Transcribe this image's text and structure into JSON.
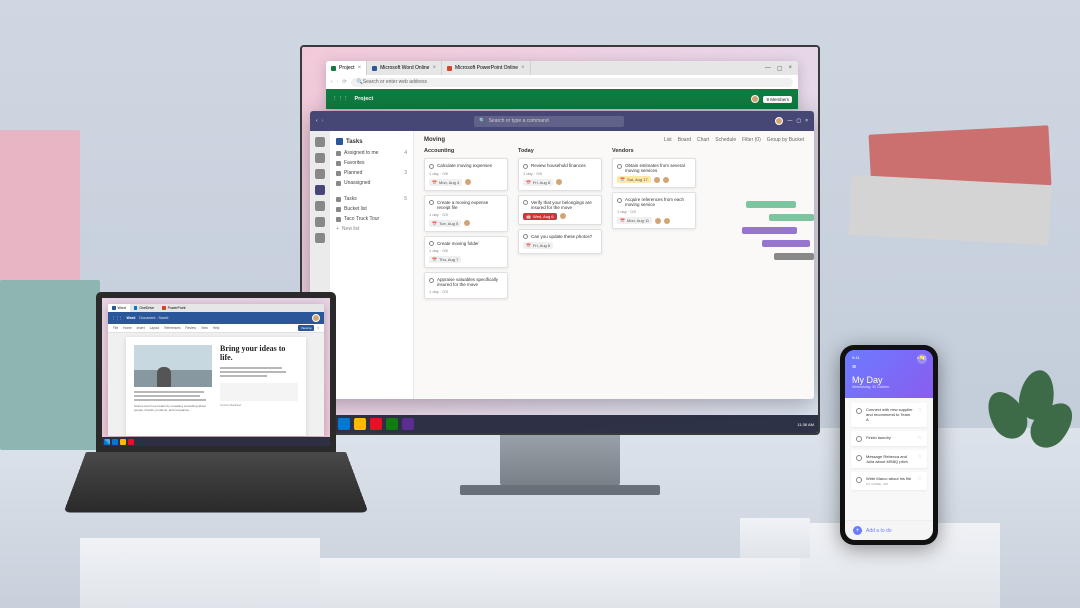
{
  "monitor": {
    "browser": {
      "tabs": [
        {
          "label": "Project",
          "color": "#107c41"
        },
        {
          "label": "Microsoft Word Online",
          "color": "#2b579a"
        },
        {
          "label": "Microsoft PowerPoint Online",
          "color": "#d24726"
        }
      ],
      "address_placeholder": "Search or enter web address",
      "ribbon_app": "Project",
      "ribbon_search": "Search or type a command",
      "member_count": "9 Members"
    },
    "tasks": {
      "title": "Tasks",
      "search_placeholder": "Search or type a command",
      "sidebar": [
        {
          "label": "Assigned to me",
          "count": "4"
        },
        {
          "label": "Favorites",
          "count": ""
        },
        {
          "label": "Planned",
          "count": "3"
        },
        {
          "label": "Unassigned",
          "count": ""
        }
      ],
      "sidebar_lists": [
        {
          "label": "Tasks",
          "count": "5"
        },
        {
          "label": "Bucket list",
          "count": ""
        },
        {
          "label": "Taco Truck Tour",
          "count": ""
        }
      ],
      "sidebar_new": "New list",
      "board_title": "Moving",
      "board_tabs": [
        "List",
        "Board",
        "Chart",
        "Schedule"
      ],
      "board_filter": "Filter (0)",
      "board_group": "Group by Bucket",
      "columns": [
        {
          "title": "Accounting",
          "cards": [
            {
              "text": "Calculate moving expenses",
              "meta": "1 day · 0/5",
              "date": "Mon, Aug 4",
              "date_style": ""
            },
            {
              "text": "Create a moving expense receipt file",
              "meta": "1 day · 0/3",
              "date": "Tue, Aug 5",
              "date_style": ""
            },
            {
              "text": "Create moving folder",
              "meta": "1 day · 0/5",
              "date": "Thu, Aug 7",
              "date_style": ""
            },
            {
              "text": "Appraise valuables specifically insured for the move",
              "meta": "1 day · 0/3",
              "date": "",
              "date_style": ""
            }
          ]
        },
        {
          "title": "Today",
          "cards": [
            {
              "text": "Review household finances",
              "meta": "1 day · 0/5",
              "date": "Fri, Aug 8",
              "date_style": ""
            },
            {
              "text": "Verify that your belongings are insured for the move",
              "meta": "",
              "date": "Wed, Aug 6",
              "date_style": "red"
            },
            {
              "text": "Can you update these photos?",
              "meta": "",
              "date": "Fri, Aug 8",
              "date_style": ""
            }
          ]
        },
        {
          "title": "Vendors",
          "cards": [
            {
              "text": "Obtain estimates from several moving services",
              "meta": "",
              "date": "Sat, Aug 17",
              "date_style": "yellow"
            },
            {
              "text": "Acquire references from each moving service",
              "meta": "1 day · 0/3",
              "date": "Mon, Aug 11",
              "date_style": ""
            }
          ]
        }
      ]
    }
  },
  "laptop": {
    "browser_tabs": [
      {
        "label": "Word",
        "color": "#2b579a"
      },
      {
        "label": "OneDrive",
        "color": "#0078d4"
      },
      {
        "label": "PowerPoint",
        "color": "#d24726"
      }
    ],
    "address_placeholder": "Search or enter web address",
    "word": {
      "title": "Word",
      "doc_title": "Document - Saved",
      "menu": [
        "File",
        "Home",
        "Insert",
        "Layout",
        "References",
        "Review",
        "View",
        "Help"
      ],
      "share": "Viewing",
      "heading": "Bring your ideas to life.",
      "body": "Stories touch our hearts by revealing something about people, brands, products, and companies.",
      "caption": "Contoso Masthead"
    }
  },
  "phone": {
    "time": "9:41",
    "title": "My Day",
    "subtitle": "Wednesday, 30 October",
    "items": [
      {
        "text": "Connect with new supplier and recommend to Team A",
        "sub": ""
      },
      {
        "text": "Finish laundry",
        "sub": ""
      },
      {
        "text": "Message Rebecca and Julia about MSBQ pitch",
        "sub": ""
      },
      {
        "text": "Write Marco about his file",
        "sub": "Fri, 14 May · 0/3"
      }
    ],
    "add_label": "Add a to do"
  },
  "taskbar_time": "11:36 AM"
}
